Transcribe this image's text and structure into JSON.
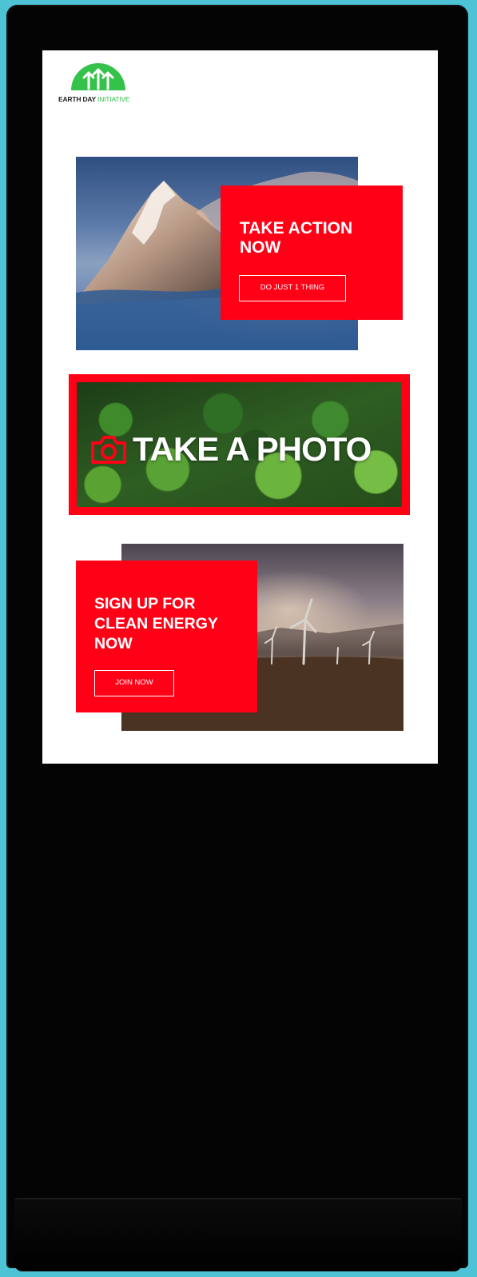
{
  "brand": {
    "logo_text_main": "EARTH DAY",
    "logo_text_accent": "INITIATIVE",
    "logo_color": "#35c24a",
    "accent_color": "#ff0016"
  },
  "cards": [
    {
      "title": "TAKE ACTION NOW",
      "button_label": "DO JUST 1 THING",
      "image": "snowy-mountain-peak"
    },
    {
      "title": "TAKE A PHOTO",
      "icon": "camera-icon",
      "image": "forest-aerial"
    },
    {
      "title": "SIGN UP FOR CLEAN ENERGY NOW",
      "button_label": "JOIN NOW",
      "image": "wind-turbines-desert"
    }
  ]
}
